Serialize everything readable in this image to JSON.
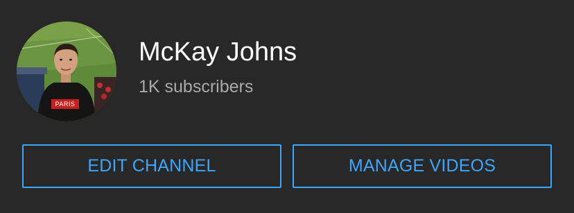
{
  "channel": {
    "name": "McKay Johns",
    "subscribers": "1K subscribers",
    "avatar_shirt_text": "PARIS"
  },
  "actions": {
    "edit_label": "EDIT CHANNEL",
    "manage_label": "MANAGE VIDEOS"
  },
  "colors": {
    "background": "#282828",
    "accent": "#3ea6ff",
    "name_text": "#ffffff",
    "secondary_text": "#aaaaaa"
  }
}
